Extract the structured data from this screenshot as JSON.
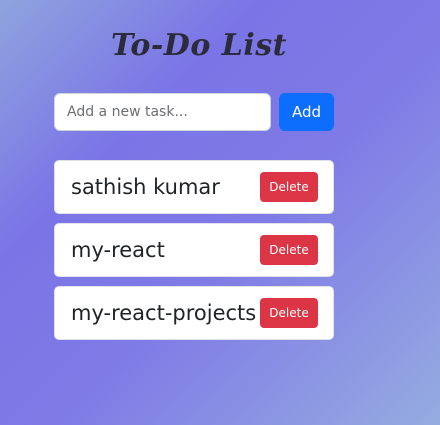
{
  "app": {
    "title": "To-Do List"
  },
  "new_task": {
    "value": "",
    "placeholder": "Add a new task...",
    "add_label": "Add"
  },
  "tasks": [
    {
      "text": "sathish kumar",
      "delete_label": "Delete"
    },
    {
      "text": "my-react",
      "delete_label": "Delete"
    },
    {
      "text": "my-react-projects",
      "delete_label": "Delete"
    }
  ],
  "colors": {
    "add_button": "#0d6efd",
    "delete_button": "#dc3545",
    "title_text": "#2b2b3b"
  }
}
